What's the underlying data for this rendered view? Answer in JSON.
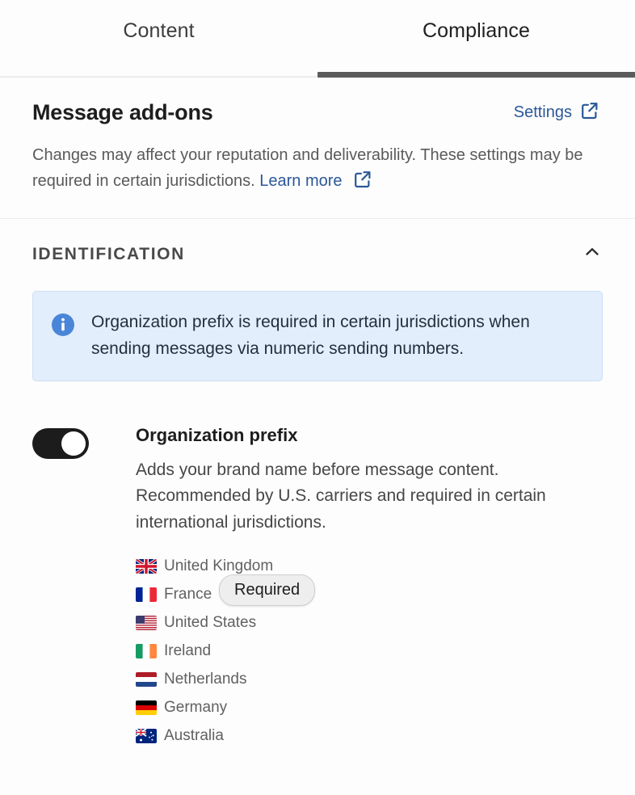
{
  "tabs": [
    {
      "label": "Content",
      "active": false
    },
    {
      "label": "Compliance",
      "active": true
    }
  ],
  "header": {
    "title": "Message add-ons",
    "settings_label": "Settings",
    "settings_icon": "external-link-icon",
    "description_part1": "Changes may affect your reputation and deliverability. These settings may be required in certain jurisdictions.",
    "learn_more_label": "Learn more",
    "learn_more_icon": "external-link-icon"
  },
  "identification": {
    "title": "IDENTIFICATION",
    "collapse_icon": "chevron-up-icon",
    "expanded": true,
    "banner": {
      "icon": "info-circle-icon",
      "text": "Organization prefix is required in certain jurisdictions when sending messages via numeric sending numbers."
    },
    "setting": {
      "toggle_state": "on",
      "label": "Organization prefix",
      "description": "Adds your brand name before message content. Recommended by U.S. carriers and required in certain international jurisdictions.",
      "countries": [
        {
          "name": "United Kingdom",
          "flag": "flag-gb"
        },
        {
          "name": "France",
          "flag": "flag-fr"
        },
        {
          "name": "United States",
          "flag": "flag-us"
        },
        {
          "name": "Ireland",
          "flag": "flag-ie"
        },
        {
          "name": "Netherlands",
          "flag": "flag-nl"
        },
        {
          "name": "Germany",
          "flag": "flag-de"
        },
        {
          "name": "Australia",
          "flag": "flag-au"
        }
      ],
      "tooltip_badge": "Required"
    }
  },
  "colors": {
    "link": "#2b5797",
    "banner_bg": "#e3eefc",
    "banner_border": "#cddff5",
    "toggle_on": "#1c1c1c",
    "active_tab_indicator": "#5b5b5b",
    "page_bg": "#fdfdfd"
  }
}
